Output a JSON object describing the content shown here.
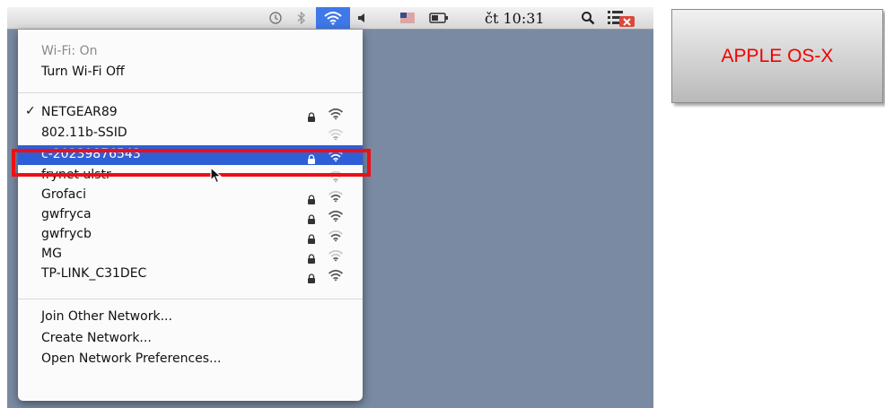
{
  "menubar": {
    "clock": "čt 10:31",
    "icons": [
      "time-machine-icon",
      "bluetooth-icon",
      "wifi-icon",
      "volume-icon",
      "flag-icon",
      "battery-icon",
      "spotlight-search-icon",
      "notification-list-icon"
    ]
  },
  "wifi_menu": {
    "status": "Wi-Fi: On",
    "toggle_label": "Turn Wi-Fi Off",
    "networks": [
      {
        "name": "NETGEAR89",
        "checked": true,
        "locked": true,
        "signal": "strong"
      },
      {
        "name": "802.11b-SSID",
        "checked": false,
        "locked": false,
        "signal": "weak"
      },
      {
        "name": "c-20239876543",
        "checked": false,
        "locked": true,
        "signal": "medium",
        "selected": true
      },
      {
        "name": "frynet ulstr",
        "checked": false,
        "locked": false,
        "signal": "weak"
      },
      {
        "name": "Grofaci",
        "checked": false,
        "locked": true,
        "signal": "medium"
      },
      {
        "name": "gwfryca",
        "checked": false,
        "locked": true,
        "signal": "strong"
      },
      {
        "name": "gwfrycb",
        "checked": false,
        "locked": true,
        "signal": "medium"
      },
      {
        "name": "MG",
        "checked": false,
        "locked": true,
        "signal": "weak"
      },
      {
        "name": "TP-LINK_C31DEC",
        "checked": false,
        "locked": true,
        "signal": "strong"
      }
    ],
    "actions": [
      "Join Other Network...",
      "Create Network...",
      "Open Network Preferences..."
    ]
  },
  "label_box": {
    "text": "APPLE OS-X"
  },
  "colors": {
    "accent": "#2f5fd6",
    "highlight_box": "#ee0f16",
    "label_text": "#f00000",
    "desktop": "#7a8aa3"
  }
}
